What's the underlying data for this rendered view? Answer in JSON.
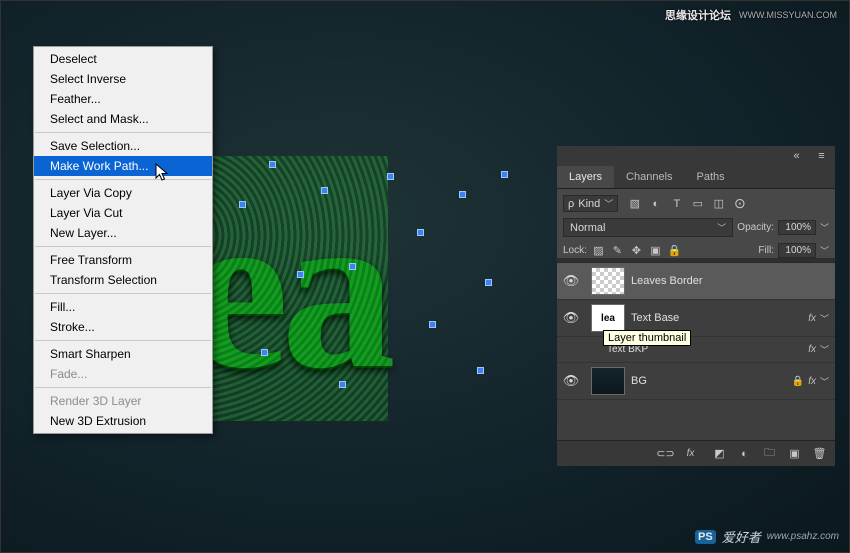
{
  "watermark": {
    "top_cn": "思缘设计论坛",
    "top_url": "WWW.MISSYUAN.COM",
    "bottom_badge": "PS",
    "bottom_text": "爱好者",
    "bottom_url": "www.psahz.com"
  },
  "canvas": {
    "visible_text": "lea"
  },
  "context_menu": {
    "items": [
      {
        "label": "Deselect",
        "disabled": false
      },
      {
        "label": "Select Inverse",
        "disabled": false
      },
      {
        "label": "Feather...",
        "disabled": false
      },
      {
        "label": "Select and Mask...",
        "disabled": false
      }
    ],
    "group2": [
      {
        "label": "Save Selection...",
        "disabled": false
      },
      {
        "label": "Make Work Path...",
        "disabled": false,
        "highlighted": true
      }
    ],
    "group3": [
      {
        "label": "Layer Via Copy",
        "disabled": false
      },
      {
        "label": "Layer Via Cut",
        "disabled": false
      },
      {
        "label": "New Layer...",
        "disabled": false
      }
    ],
    "group4": [
      {
        "label": "Free Transform",
        "disabled": false
      },
      {
        "label": "Transform Selection",
        "disabled": false
      }
    ],
    "group5": [
      {
        "label": "Fill...",
        "disabled": false
      },
      {
        "label": "Stroke...",
        "disabled": false
      }
    ],
    "group6": [
      {
        "label": "Smart Sharpen",
        "disabled": false
      },
      {
        "label": "Fade...",
        "disabled": true
      }
    ],
    "group7": [
      {
        "label": "Render 3D Layer",
        "disabled": true
      },
      {
        "label": "New 3D Extrusion",
        "disabled": false
      }
    ]
  },
  "panel": {
    "tabs": {
      "layers": "Layers",
      "channels": "Channels",
      "paths": "Paths"
    },
    "filter": {
      "prefix": "ρ",
      "kind": "Kind"
    },
    "blend_mode": "Normal",
    "opacity_label": "Opacity:",
    "opacity_value": "100%",
    "lock_label": "Lock:",
    "fill_label": "Fill:",
    "fill_value": "100%",
    "layers": [
      {
        "name": "Leaves Border",
        "visible": true,
        "thumb": "trans",
        "fx": false,
        "selected": true
      },
      {
        "name": "Text Base",
        "visible": true,
        "thumb": "txt",
        "fx": true,
        "selected": false
      },
      {
        "name": "Text BKP",
        "visible": false,
        "thumb": "txt",
        "fx": true,
        "selected": false,
        "sub": true
      },
      {
        "name": "BG",
        "visible": true,
        "thumb": "bg",
        "fx": true,
        "selected": false,
        "locked": true
      }
    ],
    "tooltip": "Layer thumbnail",
    "fx_label": "fx"
  }
}
